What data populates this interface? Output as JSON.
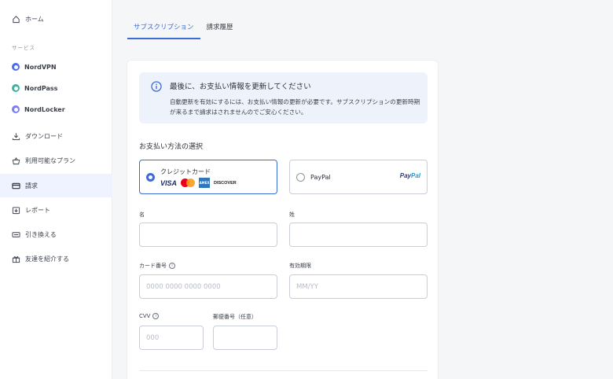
{
  "sidebar": {
    "home": "ホーム",
    "services_heading": "サービス",
    "products": [
      {
        "label": "NordVPN",
        "color": "#4a6cf0"
      },
      {
        "label": "NordPass",
        "color": "#3fb39b"
      },
      {
        "label": "NordLocker",
        "color": "#7c7ff0"
      }
    ],
    "items": [
      {
        "label": "ダウンロード",
        "icon": "download-icon"
      },
      {
        "label": "利用可能なプラン",
        "icon": "basket-icon"
      },
      {
        "label": "請求",
        "icon": "credit-card-icon",
        "active": true
      },
      {
        "label": "レポート",
        "icon": "report-icon"
      },
      {
        "label": "引き換える",
        "icon": "ticket-icon"
      },
      {
        "label": "友達を紹介する",
        "icon": "gift-icon"
      }
    ]
  },
  "tabs": [
    {
      "label": "サブスクリプション",
      "active": true
    },
    {
      "label": "請求履歴",
      "active": false
    }
  ],
  "info": {
    "title": "最後に、お支払い情報を更新してください",
    "body": "自動更新を有効にするには、お支払い情報の更新が必要です。サブスクリプションの更新時期が来るまで請求はされませんのでご安心ください。"
  },
  "payment": {
    "section_title": "お支払い方法の選択",
    "card_option": "クレジットカード",
    "card_logos": {
      "visa": "VISA",
      "amex": "AMEX",
      "discover": "DISCOVER"
    },
    "paypal_option": "PayPal",
    "paypal_logo": {
      "pay": "Pay",
      "pal": "Pal"
    }
  },
  "form": {
    "first_name_label": "名",
    "last_name_label": "姓",
    "card_number_label": "カード番号",
    "card_number_placeholder": "0000 0000 0000 0000",
    "expiry_label": "有効期限",
    "expiry_placeholder": "MM/YY",
    "cvv_label": "CVV",
    "cvv_placeholder": "000",
    "postal_label": "郵便番号（任意）"
  },
  "colors": {
    "accent": "#3d6bd6",
    "info_bg": "#eef3fb",
    "active_bg": "#eef3ff"
  }
}
